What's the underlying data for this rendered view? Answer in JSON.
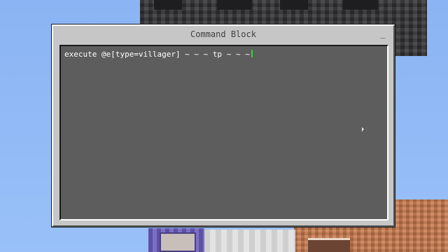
{
  "dialog": {
    "title": "Command Block",
    "minimize_label": "_",
    "command_text": "execute @e[type=villager] ~ ~ ~ tp ~ ~ ~"
  },
  "colors": {
    "caret": "#31d431",
    "editor_bg": "#5d5d5d",
    "dialog_bg": "#c6c6c6"
  },
  "icons": {
    "minimize": "minimize-icon",
    "mouse_pointer": "mouse-pointer-icon"
  }
}
